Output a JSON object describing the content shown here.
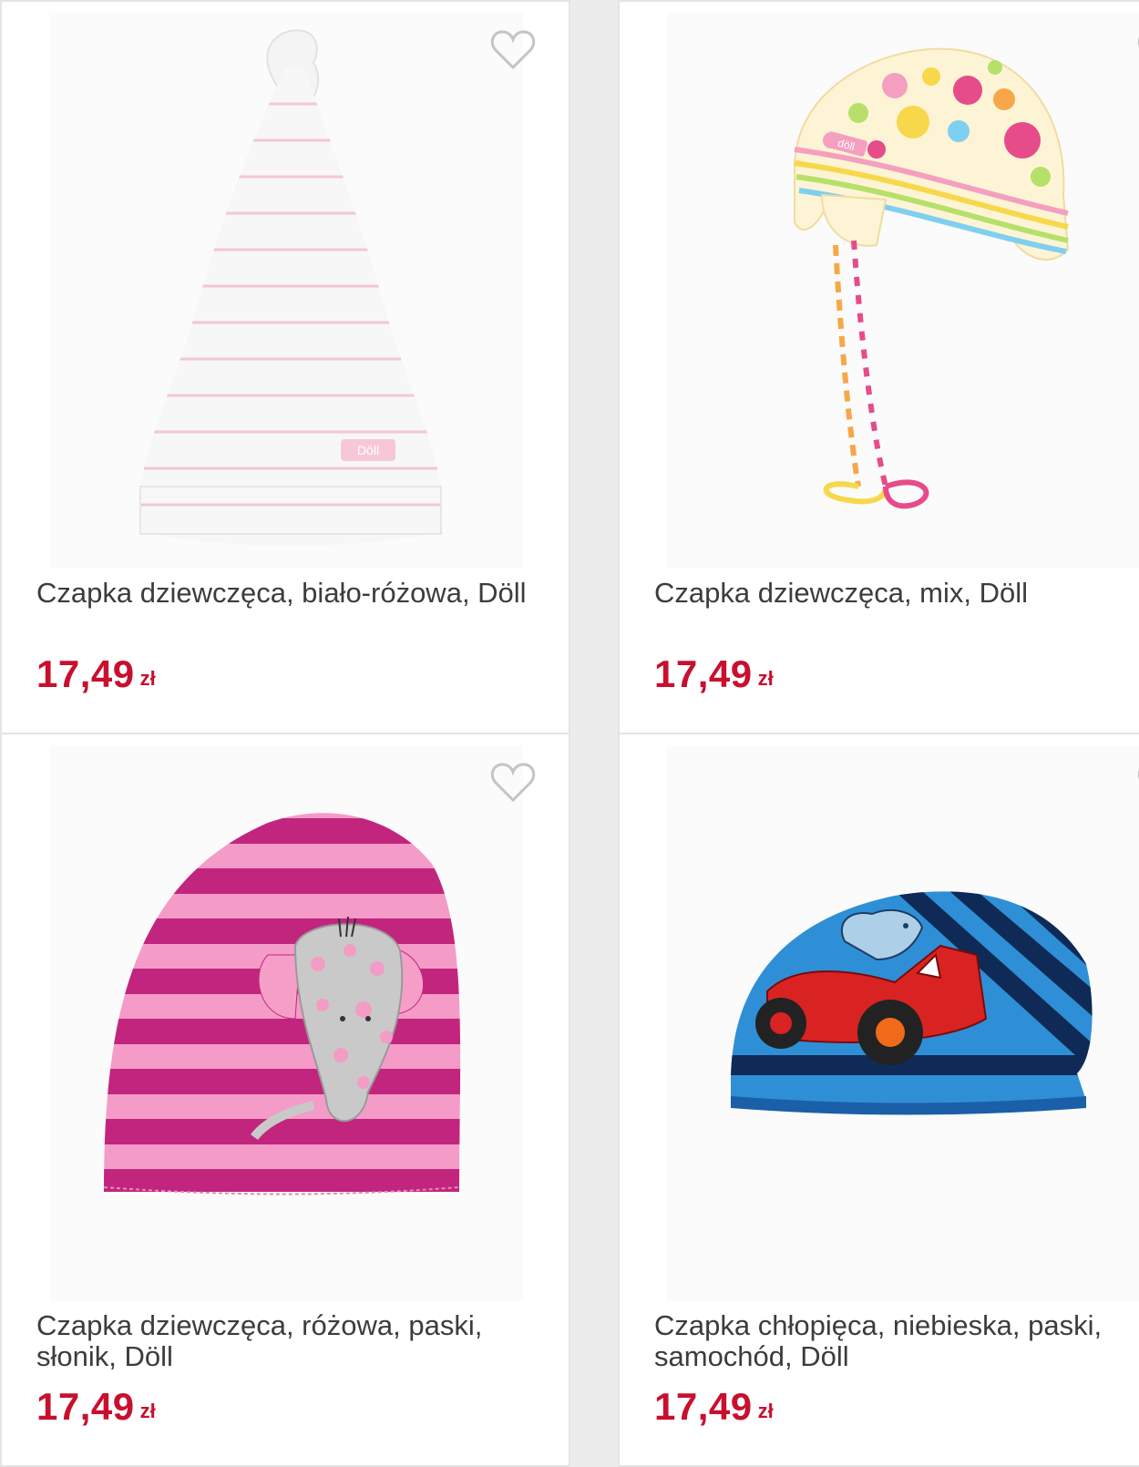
{
  "colors": {
    "price": "#c8102e",
    "title": "#3c3c3c",
    "card_border": "#e4e4e4",
    "background": "#ececec",
    "heart_outline": "#c4c4c4"
  },
  "products": [
    {
      "title": "Czapka dziewczęca, biało-różowa, Döll",
      "price": "17,49",
      "currency": "zł",
      "image_label": "Döll",
      "wishlist_icon": "heart-outline-icon"
    },
    {
      "title": "Czapka dziewczęca, mix, Döll",
      "price": "17,49",
      "currency": "zł",
      "image_label": "döll",
      "wishlist_icon": "heart-outline-icon"
    },
    {
      "title": "Czapka dziewczęca, różowa, paski, słonik, Döll",
      "price": "17,49",
      "currency": "zł",
      "wishlist_icon": "heart-outline-icon"
    },
    {
      "title": "Czapka chłopięca, niebieska, paski, samochód, Döll",
      "price": "17,49",
      "currency": "zł",
      "wishlist_icon": "heart-outline-icon"
    }
  ]
}
